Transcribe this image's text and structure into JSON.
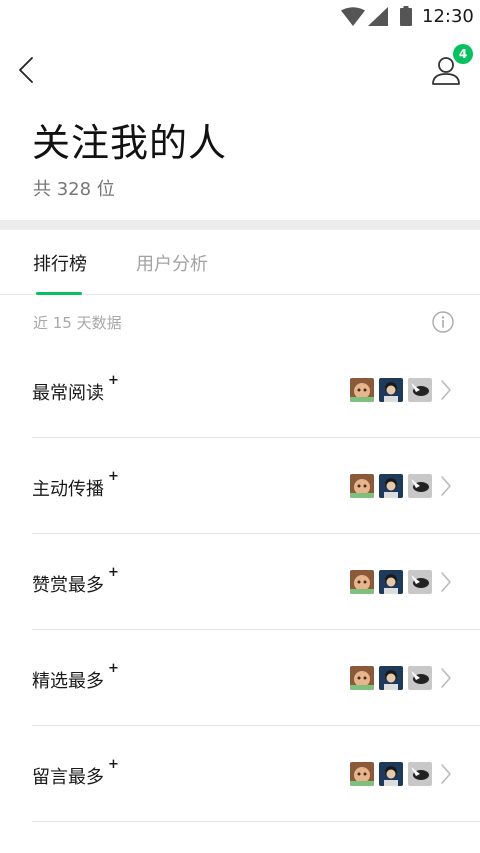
{
  "status_bar": {
    "time": "12:30"
  },
  "header": {
    "title": "关注我的人",
    "count_text": "共 328 位",
    "notification_badge": "4"
  },
  "tabs": [
    {
      "label": "排行榜",
      "active": true
    },
    {
      "label": "用户分析",
      "active": false
    }
  ],
  "data_range": "近 15 天数据",
  "rank_items": [
    {
      "label": "最常阅读",
      "plus": "+"
    },
    {
      "label": "主动传播",
      "plus": "+"
    },
    {
      "label": "赞赏最多",
      "plus": "+"
    },
    {
      "label": "精选最多",
      "plus": "+"
    },
    {
      "label": "留言最多",
      "plus": "+"
    }
  ],
  "colors": {
    "accent": "#07c160",
    "divider": "#ededed",
    "muted_text": "#a3a3a3"
  }
}
